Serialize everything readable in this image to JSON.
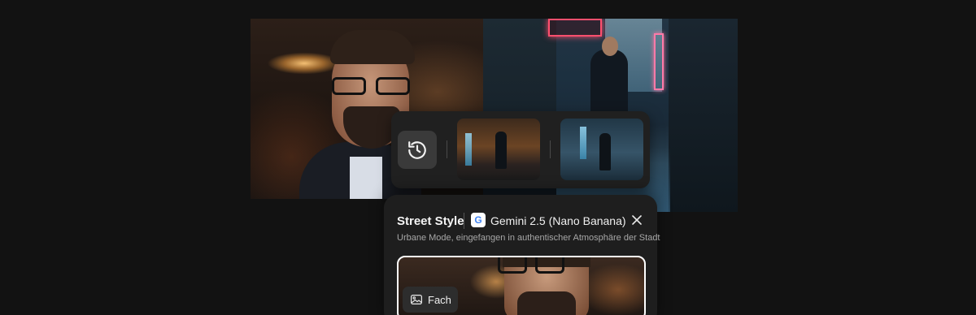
{
  "background_photos": [
    {
      "name": "portrait-photo",
      "subject": "man with glasses and beard in warm cafe light"
    },
    {
      "name": "street-photo",
      "subject": "man in dark jacket on neon city street at night"
    }
  ],
  "history": {
    "icon": "history-icon",
    "thumbnails": [
      {
        "subject": "man standing in lit underpass"
      },
      {
        "subject": "man on wet neon street"
      }
    ]
  },
  "panel": {
    "title": "Street Style",
    "model": {
      "icon": "google-icon",
      "logo_letter": "G",
      "label": "Gemini 2.5 (Nano Banana)"
    },
    "close_icon": "close-icon",
    "description": "Urbane Mode, eingefangen in authentischer Atmosphäre der Stadt",
    "preview": {
      "chip_icon": "image-icon",
      "chip_label": "Fach"
    }
  },
  "colors": {
    "page_background": "#121212",
    "panel_background": "#1e1e1e",
    "history_background": "#202020",
    "chip_background": "#2d2d2d",
    "text_primary": "#f4f4f4",
    "text_secondary": "#a7a7a7",
    "google_blue": "#4285f4"
  }
}
